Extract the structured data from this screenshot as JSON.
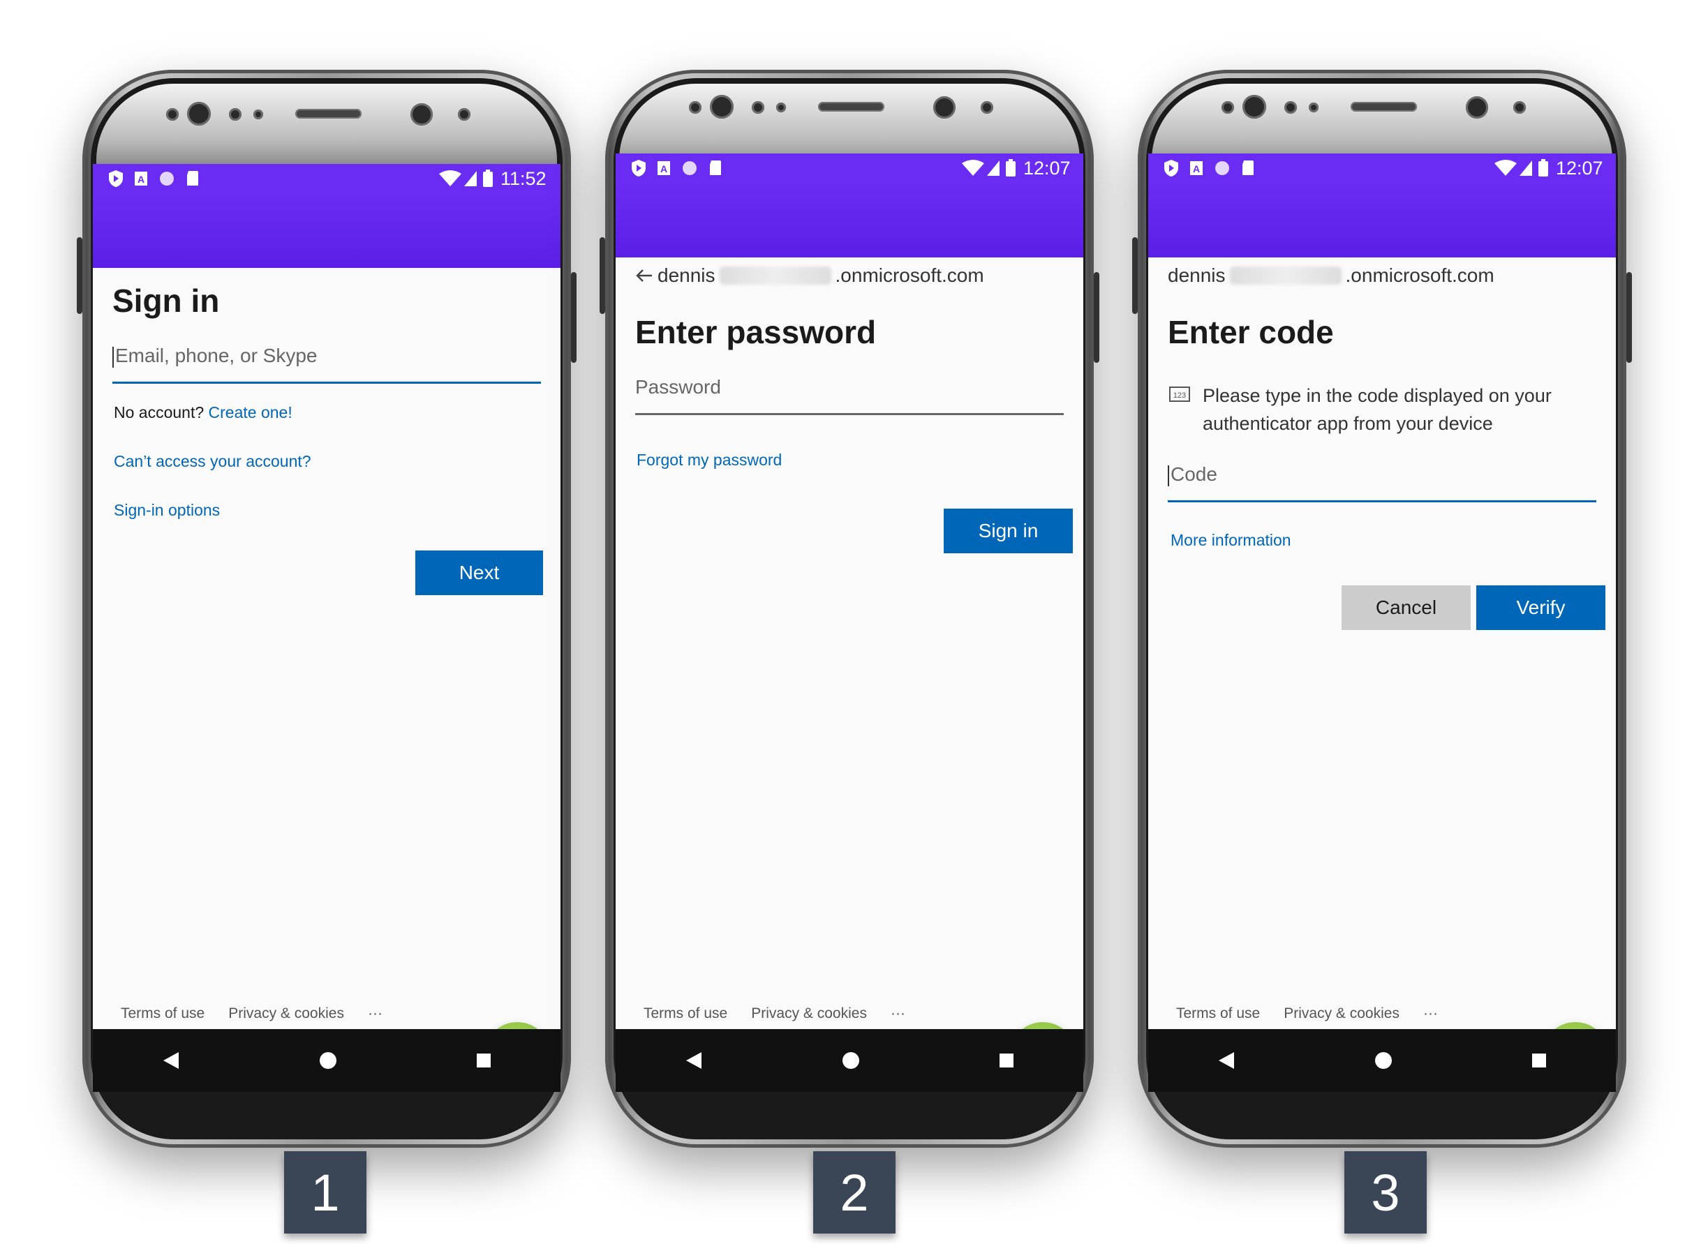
{
  "status": {
    "phone1_time": "11:52",
    "phone2_time": "12:07",
    "phone3_time": "12:07"
  },
  "screen1": {
    "title": "Sign in",
    "email_placeholder": "Email, phone, or Skype",
    "no_account_text": "No account?",
    "create_link": "Create one!",
    "cant_access_link": "Can’t access your account?",
    "signin_options_link": "Sign-in options",
    "next_button": "Next"
  },
  "screen2": {
    "email_prefix": "dennis",
    "email_suffix": ".onmicrosoft.com",
    "title": "Enter password",
    "password_placeholder": "Password",
    "forgot_link": "Forgot my password",
    "signin_button": "Sign in"
  },
  "screen3": {
    "email_prefix": "dennis",
    "email_suffix": ".onmicrosoft.com",
    "title": "Enter code",
    "instruction": "Please type in the code displayed on your authenticator app from your device",
    "code_placeholder": "Code",
    "more_info_link": "More information",
    "cancel_button": "Cancel",
    "verify_button": "Verify"
  },
  "footer": {
    "terms": "Terms of use",
    "privacy": "Privacy & cookies",
    "more": "···"
  },
  "step_badges": [
    "1",
    "2",
    "3"
  ],
  "colors": {
    "accent": "#6a2cf3",
    "button": "#0067b8",
    "fab": "#8bc34a",
    "badge": "#3a4656"
  },
  "icons": {
    "fab": "lock-icon",
    "back": "arrow-left-icon",
    "code": "keypad-123-icon"
  }
}
